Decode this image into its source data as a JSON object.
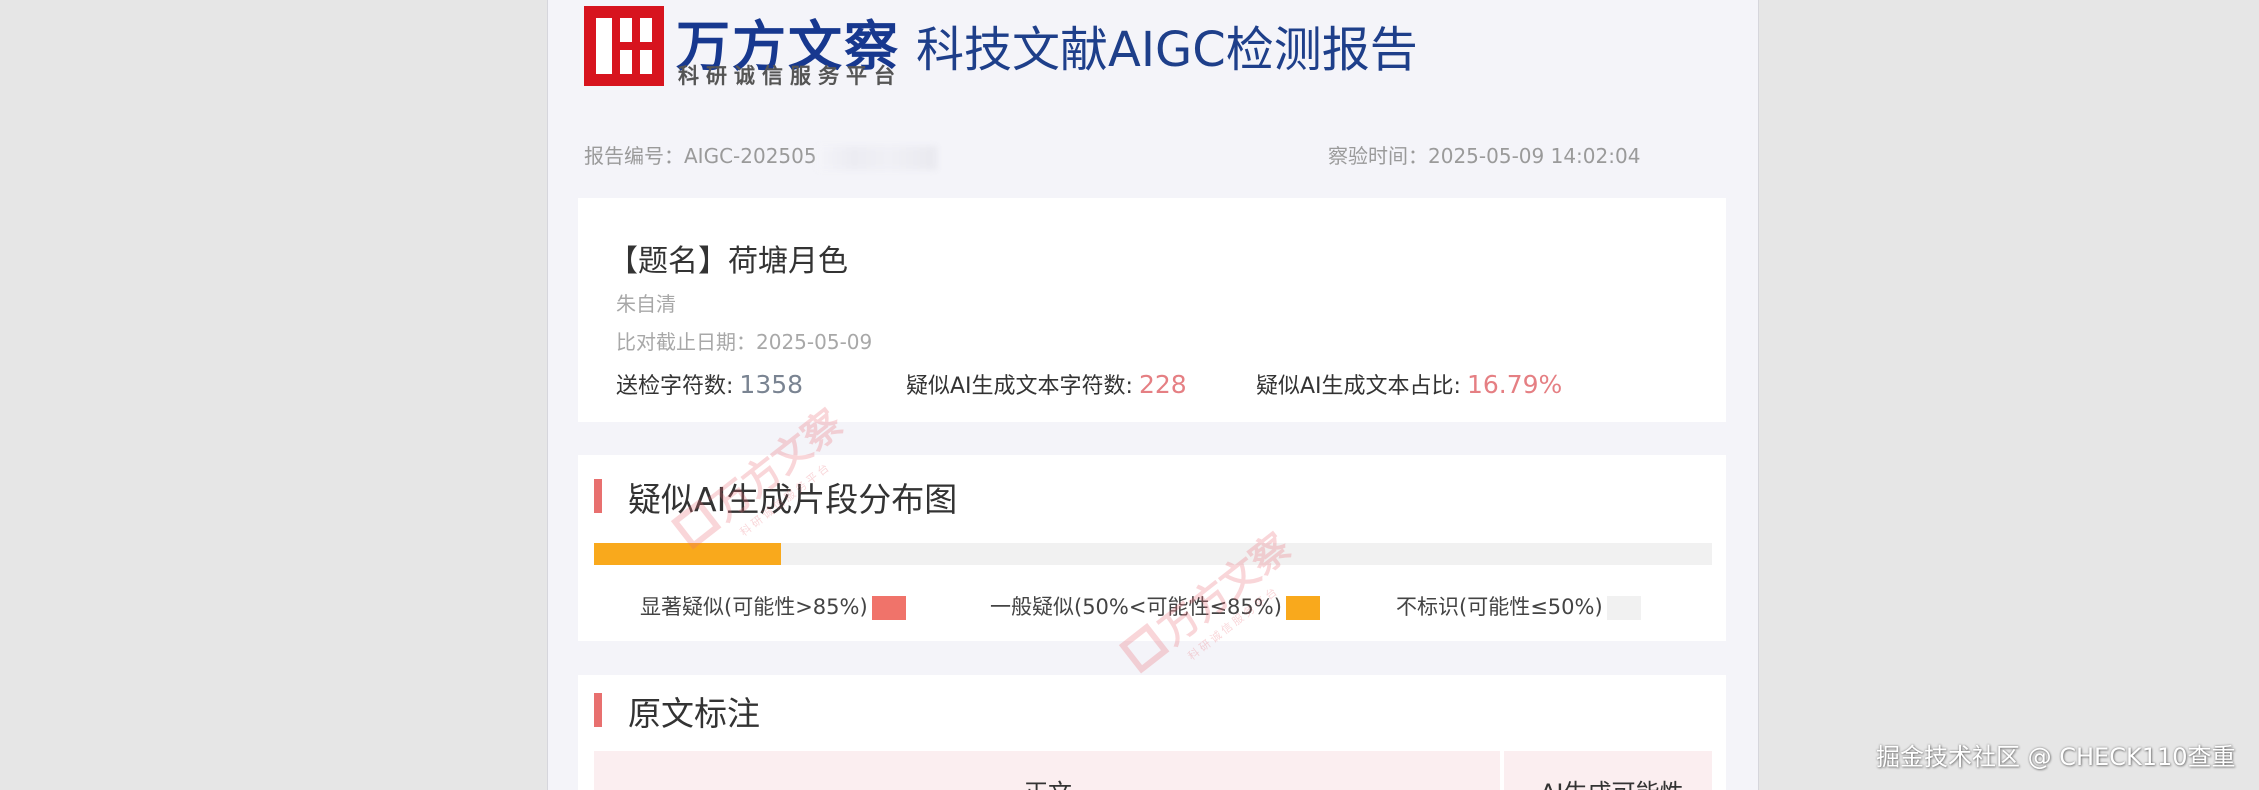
{
  "header": {
    "brand_name": "万方文察",
    "brand_sub": "科研诚信服务平台",
    "report_title": "科技文献AIGC检测报告"
  },
  "meta": {
    "report_no_label": "报告编号：",
    "report_no_value": "AIGC-202505",
    "check_time_label": "察验时间：",
    "check_time_value": "2025-05-09 14:02:04"
  },
  "document": {
    "title": "【题名】荷塘月色",
    "author": "朱自清",
    "cutoff_label": "比对截止日期：",
    "cutoff_value": "2025-05-09"
  },
  "stats": [
    {
      "label": "送检字符数:",
      "value": "1358",
      "tone": "grey"
    },
    {
      "label": "疑似AI生成文本字符数:",
      "value": "228",
      "tone": "pink"
    },
    {
      "label": "疑似AI生成文本占比:",
      "value": "16.79%",
      "tone": "pink"
    }
  ],
  "distribution": {
    "title": "疑似AI生成片段分布图",
    "segments": [
      {
        "start": 0.0,
        "end": 0.167,
        "level": "general"
      }
    ],
    "colors": {
      "significant": "#f0736a",
      "general": "#f9a91c",
      "none": "#f1f1f1"
    },
    "legend": [
      {
        "label": "显著疑似(可能性>85%)",
        "level": "significant"
      },
      {
        "label": "一般疑似(50%<可能性≤85%)",
        "level": "general"
      },
      {
        "label": "不标识(可能性≤50%)",
        "level": "none"
      }
    ]
  },
  "original": {
    "title": "原文标注",
    "col_main": "正文",
    "col_ai": "AI生成可能性"
  },
  "watermark": {
    "text": "万方文察",
    "sub": "科研诚信服务平台"
  },
  "corner_credit": "掘金技术社区 @ CHECK110查重"
}
